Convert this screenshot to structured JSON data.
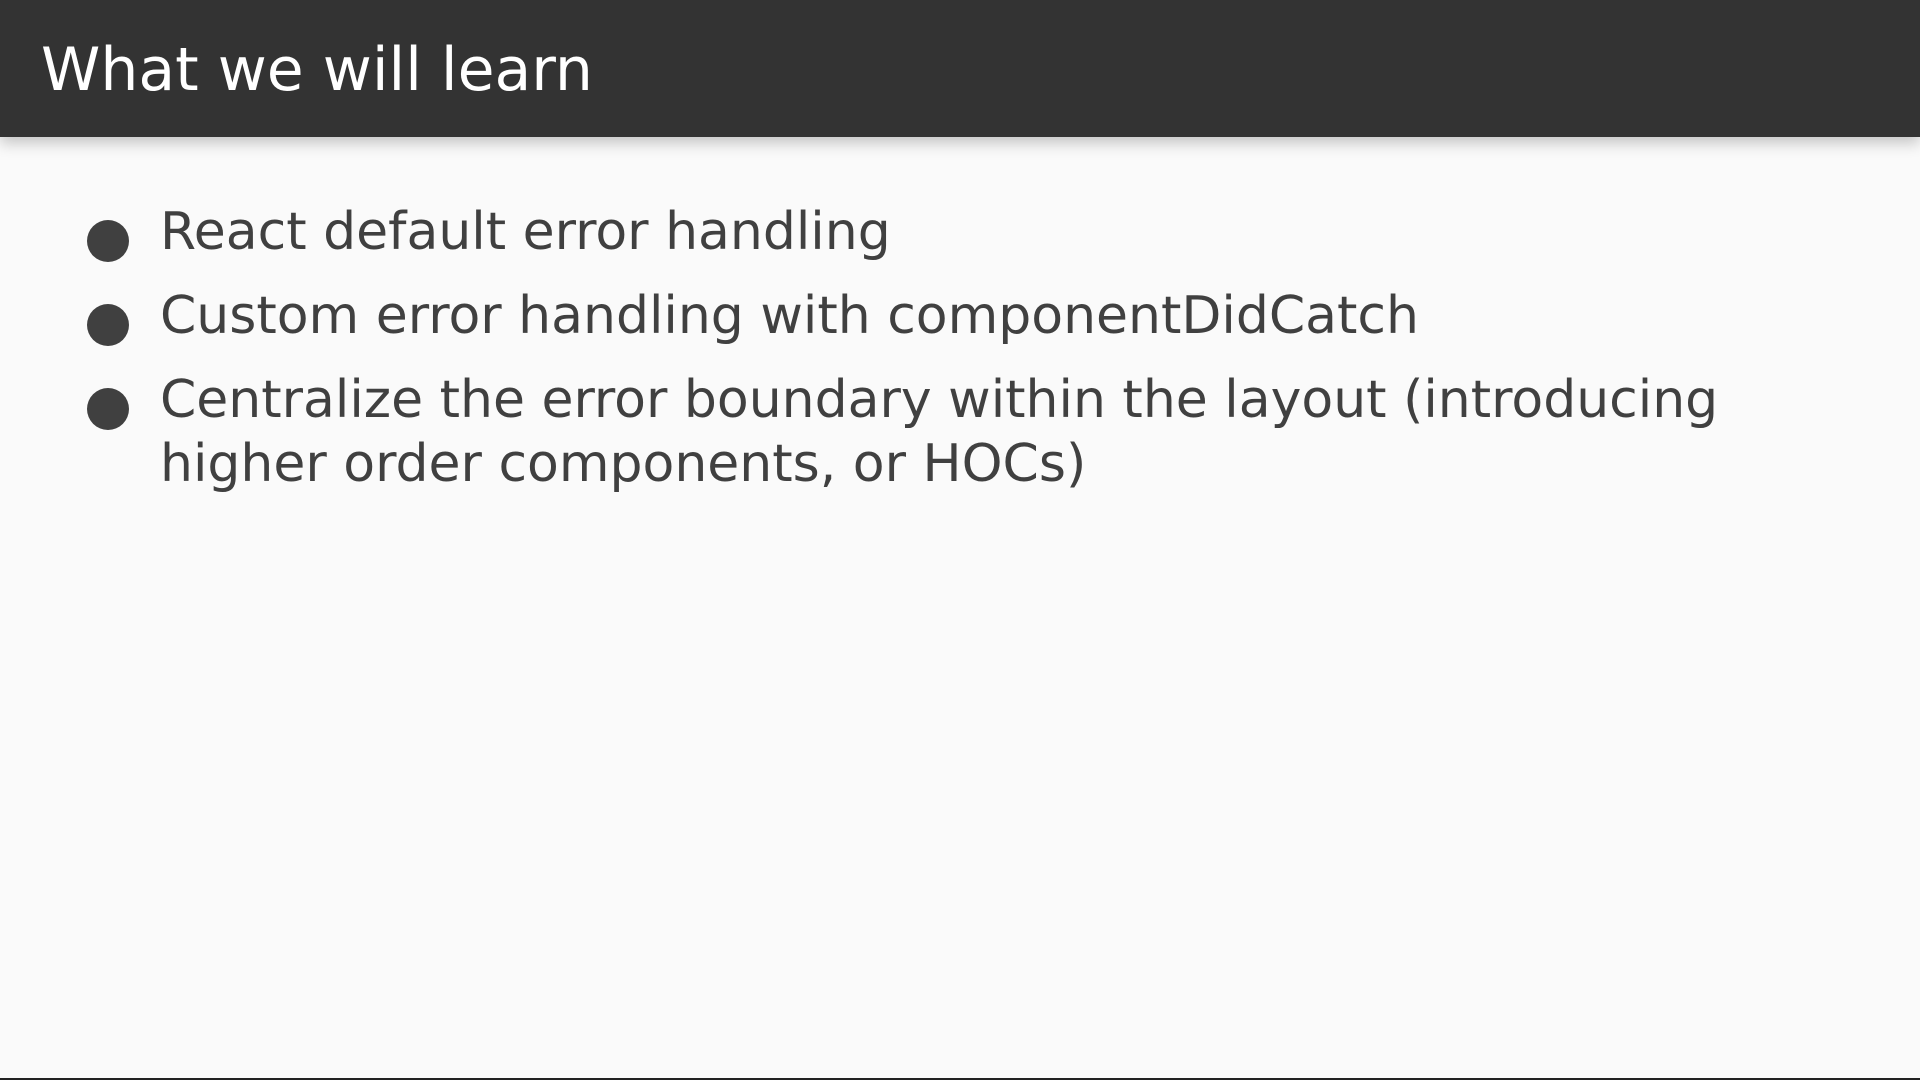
{
  "slide": {
    "title": "What we will learn",
    "bullets": [
      "React default error handling",
      "Custom error handling with componentDidCatch",
      "Centralize the error boundary within the layout (introducing higher order components, or HOCs)"
    ]
  },
  "colors": {
    "header_bg": "#333333",
    "title_text": "#ffffff",
    "body_bg": "#fafafa",
    "body_text": "#404040"
  }
}
